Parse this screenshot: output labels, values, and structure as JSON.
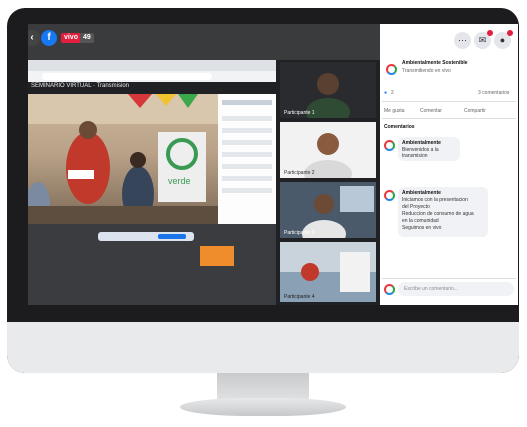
{
  "fb_bar": {
    "live_badge": "vivo",
    "views": "49"
  },
  "header": {
    "page_name": "Ambientalmente Sostenible",
    "subtitle": "Transmitiendo en vivo",
    "reactions_count": "2",
    "comments_count": "3 comentarios"
  },
  "actions": {
    "like": "Me gusta",
    "comment": "Comentar",
    "share": "Compartir"
  },
  "comments_header": "Comentarios",
  "comments": [
    {
      "author": "Ambientalmente",
      "line1": "Bienvenidos a la",
      "line2": "transmision"
    },
    {
      "author": "Ambientalmente",
      "line1": "Iniciamos con la presentacion",
      "line2": "del Proyecto",
      "line3": "Reduccion de consumo de agua",
      "line4": "en la comunidad",
      "line5": "Seguimos en vivo"
    }
  ],
  "comment_input": {
    "placeholder": "Escribe un comentario..."
  },
  "shared_screen": {
    "toolbar_title": "SEMINARIO VIRTUAL · Transmision"
  },
  "gallery": [
    {
      "name": "Participante 1"
    },
    {
      "name": "Participante 2"
    },
    {
      "name": "Participante 3"
    },
    {
      "name": "Participante 4"
    }
  ],
  "presentation_logo": "verde"
}
